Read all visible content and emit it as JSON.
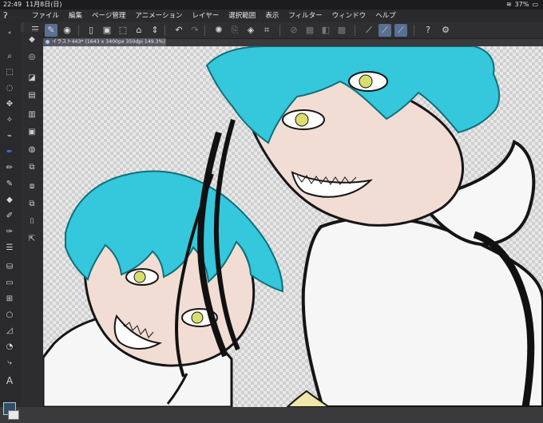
{
  "status_bar": {
    "time": "22:49",
    "date": "11月8日(日)",
    "battery": "37%"
  },
  "menu": {
    "items": [
      "ファイル",
      "編集",
      "ページ管理",
      "アニメーション",
      "レイヤー",
      "選択範囲",
      "表示",
      "フィルター",
      "ウィンドウ",
      "ヘルプ"
    ]
  },
  "canvas_tab": {
    "label": "イラスト443* (1643 x 3400px 350dpi 149.3%)"
  },
  "icons": {
    "app_logo": "clip-studio-logo-icon",
    "wifi": "wifi-icon",
    "battery": "battery-icon"
  },
  "colors": {
    "accent": "#5a6f92",
    "hair": "#35c7db",
    "line": "#151515",
    "skin": "#f1ddd3",
    "eyes": "#d8df6f"
  }
}
